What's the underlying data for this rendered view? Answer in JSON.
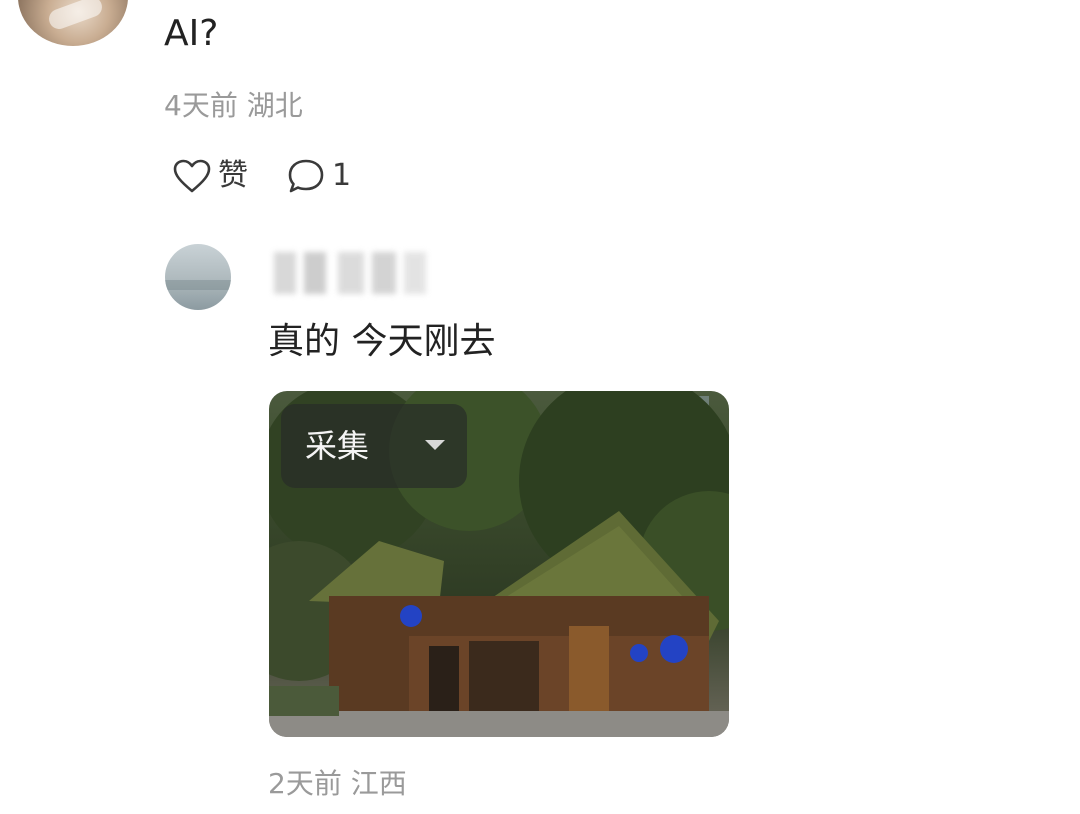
{
  "top_comment": {
    "text": "AI?",
    "time": "4天前",
    "location": "湖北",
    "like_label": "赞",
    "reply_count": "1"
  },
  "reply": {
    "text": "真的 今天刚去",
    "image_overlay": {
      "collect_label": "采集"
    },
    "time": "2天前",
    "location": "江西"
  },
  "icons": {
    "like": "heart-outline-icon",
    "comment": "speech-bubble-icon",
    "dropdown": "caret-down-icon"
  },
  "colors": {
    "meta_text": "#9a9a9a",
    "body_text": "#222222"
  }
}
